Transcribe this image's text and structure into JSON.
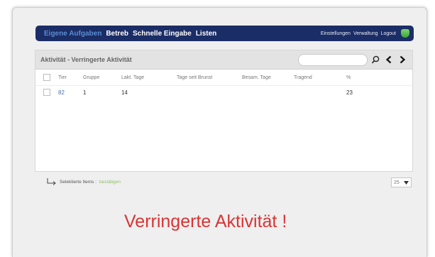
{
  "nav": {
    "active": "Eigene Aufgaben",
    "items": [
      "Betreb",
      "Schnelle Eingabe",
      "Listen"
    ],
    "right": [
      "Einstellungen",
      "Verwaltung",
      "Logout"
    ]
  },
  "panel": {
    "title": "Aktivität - Verringerte Aktivität",
    "search_placeholder": ""
  },
  "table": {
    "headers": [
      "Tier",
      "Gruppe",
      "Lakt. Tage",
      "Tage seit Brunst",
      "Besam. Tage",
      "Tragend",
      "%"
    ],
    "rows": [
      {
        "tier": "82",
        "gruppe": "1",
        "lakt_tage": "14",
        "tage_seit_brunst": "",
        "besam_tage": "",
        "tragend": "",
        "pct": "23"
      }
    ]
  },
  "bulk": {
    "label": "Selektierte Items :",
    "action": "bestätigen"
  },
  "pager": {
    "value": "25"
  },
  "notice": "Verringerte Aktivität !",
  "colors": {
    "nav_bg": "#1b2d66",
    "notice": "#d93434",
    "link": "#4a6fb3"
  },
  "icons": [
    "shield-icon",
    "search-icon",
    "chevron-left-icon",
    "chevron-right-icon",
    "return-arrow-icon",
    "dropdown-arrow-icon"
  ]
}
